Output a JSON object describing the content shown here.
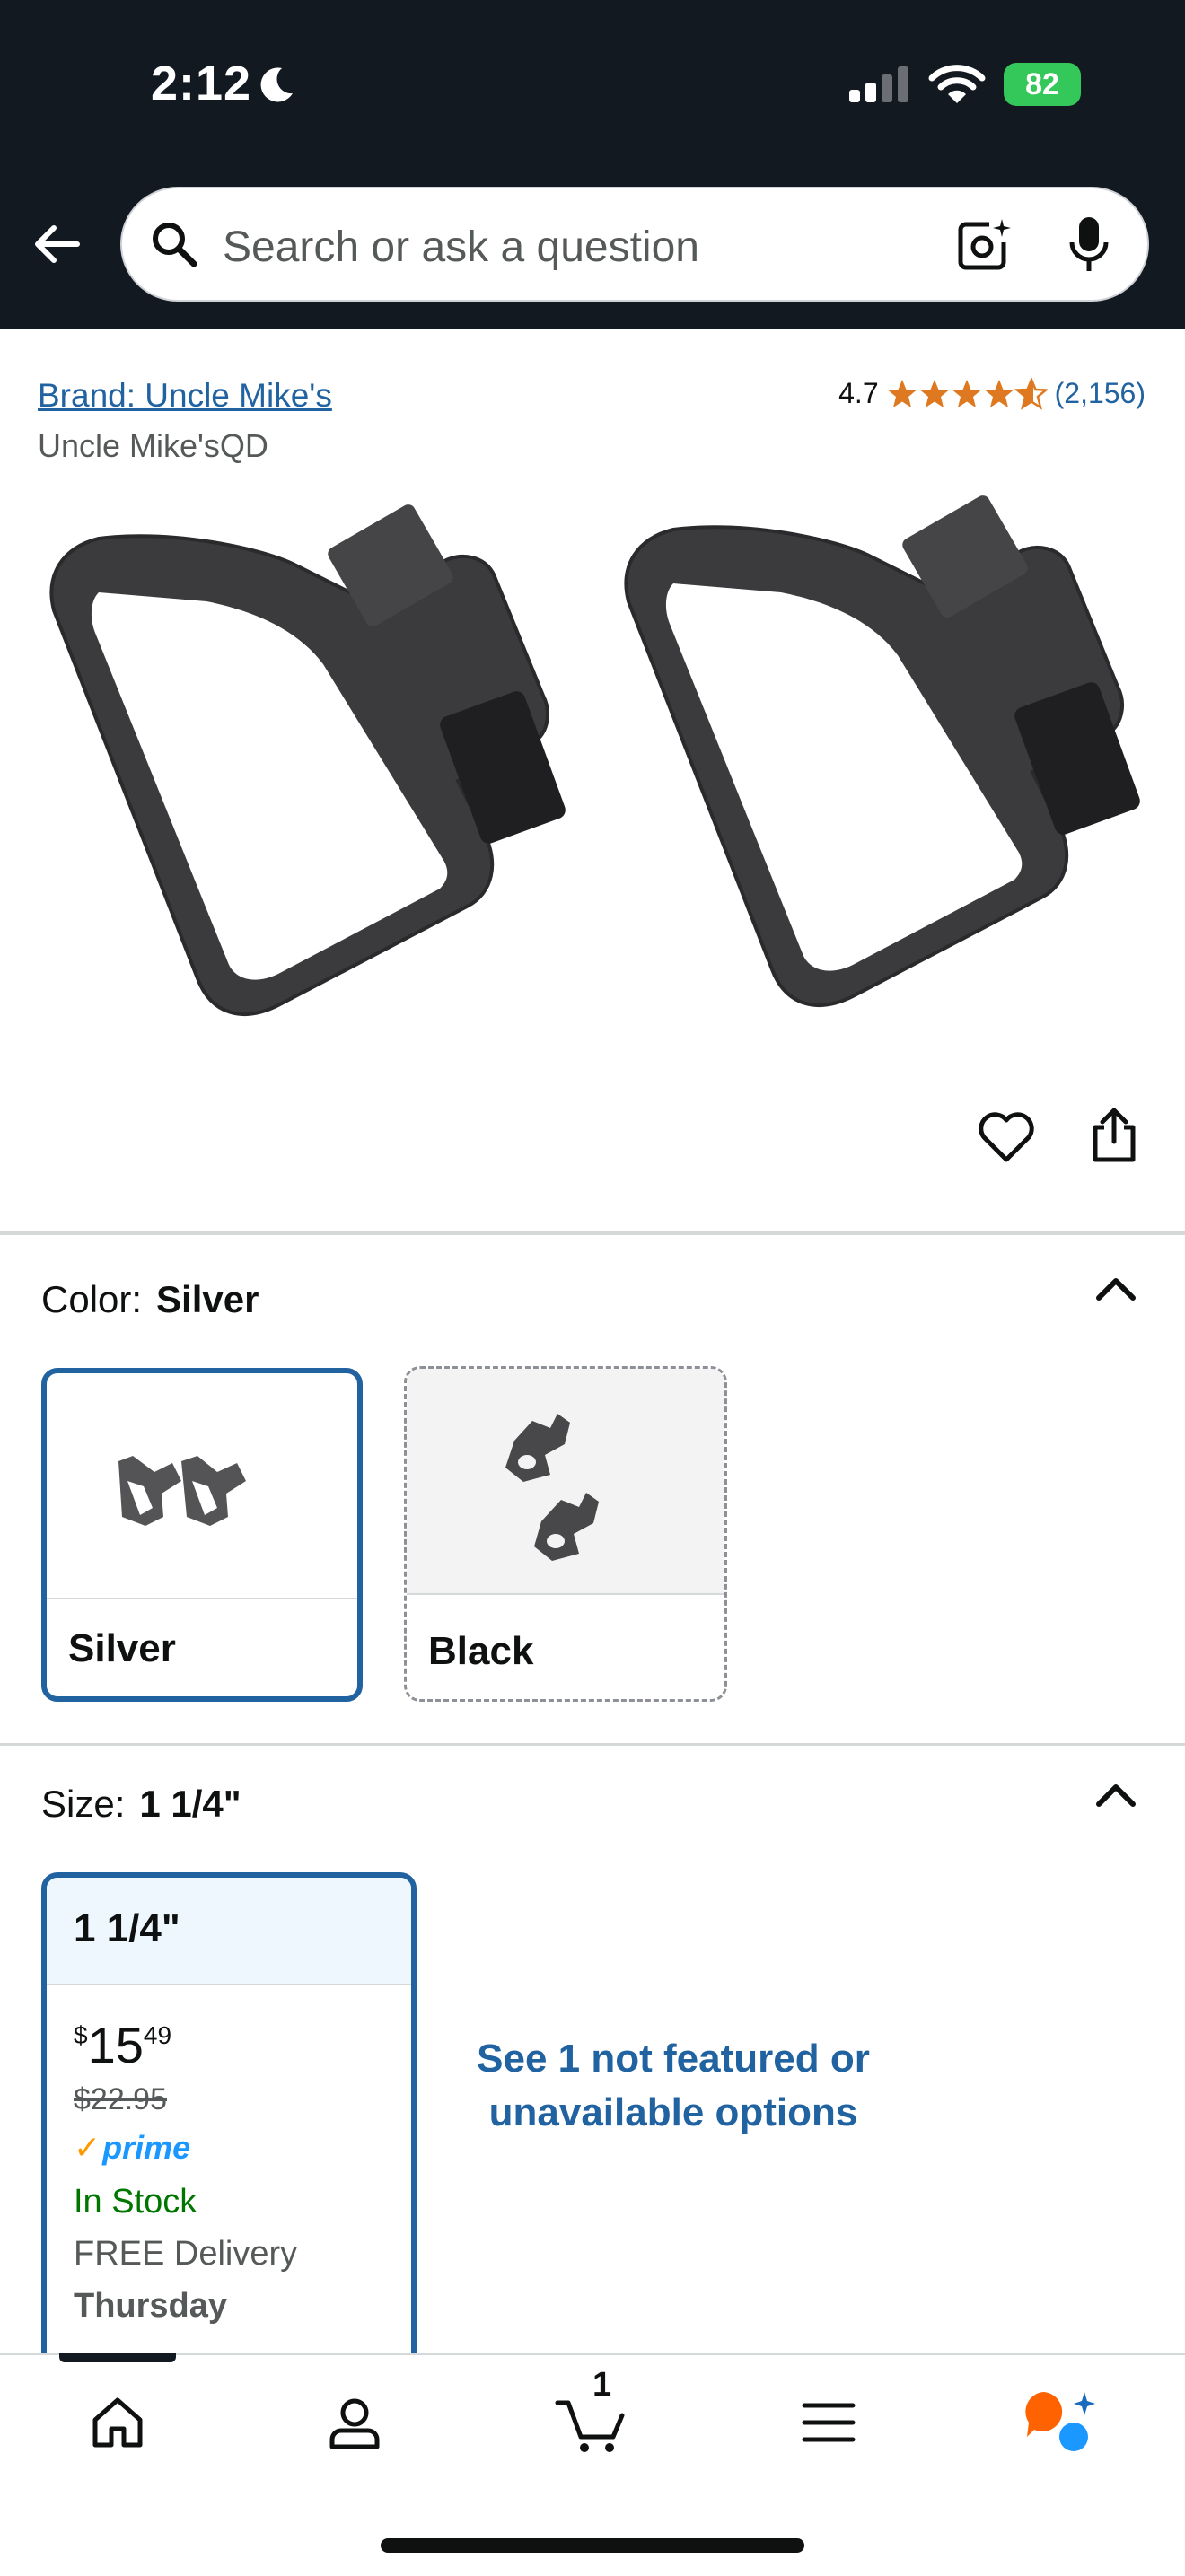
{
  "status_bar": {
    "time": "2:12",
    "battery": "82"
  },
  "search": {
    "placeholder": "Search or ask a question"
  },
  "product": {
    "brand_link": "Brand: Uncle Mike's",
    "subtitle": "Uncle Mike'sQD",
    "rating": "4.7",
    "rating_stars": 4.7,
    "rating_count": "(2,156)"
  },
  "color_section": {
    "label": "Color:",
    "selected": "Silver",
    "options": [
      {
        "label": "Silver",
        "selected": true
      },
      {
        "label": "Black",
        "selected": false
      }
    ]
  },
  "size_section": {
    "label": "Size:",
    "selected": "1 1/4\"",
    "card": {
      "title": "1 1/4\"",
      "currency": "$",
      "price_whole": "15",
      "price_fraction": "49",
      "list_price": "$22.95",
      "prime": "prime",
      "stock": "In Stock",
      "delivery": "FREE Delivery",
      "delivery_day": "Thursday"
    },
    "not_featured": "See 1 not featured or unavailable options"
  },
  "bottom_nav": {
    "items": [
      "home-icon",
      "account-icon",
      "cart-icon",
      "menu-icon",
      "rufus-icon"
    ],
    "cart_count": "1"
  },
  "colors": {
    "header_bg": "#131921",
    "link_blue": "#2162a1",
    "star_orange": "#de7921",
    "in_stock_green": "#007600",
    "battery_green": "#34c759"
  }
}
